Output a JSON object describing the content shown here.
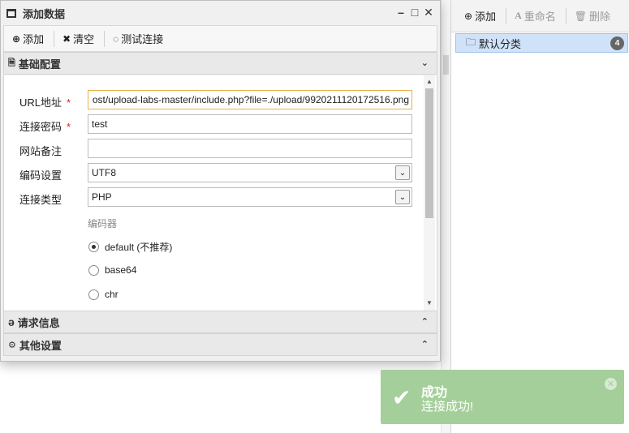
{
  "dialog": {
    "title": "添加数据",
    "controls": {
      "minimize": "–",
      "maximize": "□",
      "close": "✕"
    },
    "toolbar": {
      "add_label": "添加",
      "clear_label": "清空",
      "test_label": "测试连接"
    },
    "sections": {
      "basic": "基础配置",
      "request": "请求信息",
      "other": "其他设置"
    },
    "form": {
      "url_label": "URL地址",
      "url_value": "ost/upload-labs-master/include.php?file=./upload/9920211120172516.png",
      "password_label": "连接密码",
      "password_value": "test",
      "note_label": "网站备注",
      "note_value": "",
      "encoding_label": "编码设置",
      "encoding_value": "UTF8",
      "type_label": "连接类型",
      "type_value": "PHP",
      "required_mark": "*",
      "encoder_label": "编码器",
      "encoders": [
        {
          "label": "default (不推荐)",
          "checked": true
        },
        {
          "label": "base64",
          "checked": false
        },
        {
          "label": "chr",
          "checked": false
        }
      ]
    }
  },
  "right_panel": {
    "toolbar": {
      "add_label": "添加",
      "rename_label": "重命名",
      "delete_label": "删除"
    },
    "category": {
      "label": "默认分类",
      "count": "4"
    }
  },
  "toast": {
    "title": "成功",
    "message": "连接成功!",
    "color": "#a5cf9a"
  }
}
